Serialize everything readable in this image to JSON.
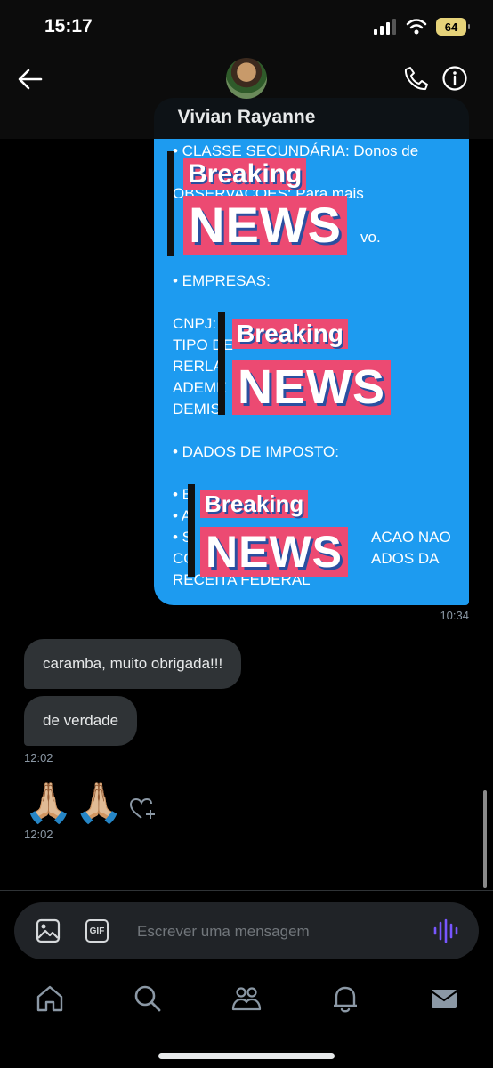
{
  "status_bar": {
    "time": "15:17",
    "battery": "64"
  },
  "header": {
    "contact_name": "Vivian Rayanne"
  },
  "sent_message": {
    "lines": [
      "• CLASSE SECUNDÁRIA: Donos de",
      "OBSERVAÇÕES: Para mais",
      "vo.",
      "• EMPRESAS:",
      "CNPJ:",
      "TIPO DE",
      "RERLA",
      "ADEME",
      "DEMIS",
      "• DADOS DE IMPOSTO:",
      "• B",
      "• A",
      "• S",
      "CO",
      "RECEITA FEDERAL",
      "ACAO NAO",
      "ADOS DA"
    ],
    "time": "10:34"
  },
  "stickers": {
    "breaking": "Breaking",
    "news": "NEWS"
  },
  "received_messages": [
    {
      "text": "caramba, muito obrigada!!!"
    },
    {
      "text": "de verdade",
      "time": "12:02"
    }
  ],
  "emoji_message": {
    "text": "🙏🏼🙏🏼",
    "time": "12:02"
  },
  "composer": {
    "gif_label": "GIF",
    "placeholder": "Escrever uma mensagem"
  },
  "icons": {
    "back": "arrow-left-icon",
    "call": "phone-icon",
    "info": "info-icon",
    "image": "image-icon",
    "gif": "gif-icon",
    "voice": "voice-wave-icon",
    "home": "home-icon",
    "search": "search-icon",
    "communities": "people-icon",
    "notifications": "bell-icon",
    "messages": "envelope-icon"
  },
  "colors": {
    "sent_bubble": "#1d9bf0",
    "received_bubble": "#2f3336",
    "sticker": "#ec4a72",
    "voice_accent": "#7856ff"
  }
}
